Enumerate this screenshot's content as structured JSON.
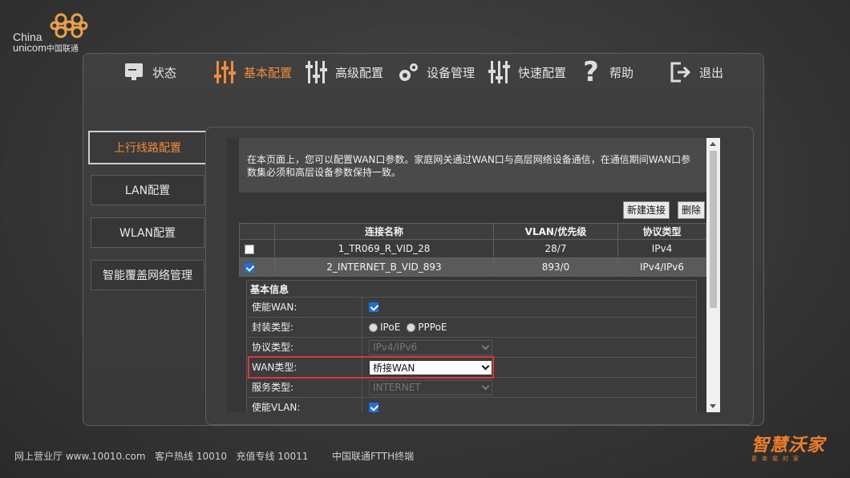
{
  "logo": {
    "en_line1": "China",
    "en_line2": "unicom",
    "cn": "中国联通"
  },
  "nav": [
    {
      "label": "状态",
      "icon": "monitor-icon"
    },
    {
      "label": "基本配置",
      "icon": "sliders-icon"
    },
    {
      "label": "高级配置",
      "icon": "sliders-advanced-icon"
    },
    {
      "label": "设备管理",
      "icon": "gears-icon"
    },
    {
      "label": "快速配置",
      "icon": "quick-sliders-icon"
    },
    {
      "label": "帮助",
      "icon": "question-icon"
    },
    {
      "label": "退出",
      "icon": "exit-icon"
    }
  ],
  "active_color": "#f08a3c",
  "menu": [
    {
      "label": "上行线路配置"
    },
    {
      "label": "LAN配置"
    },
    {
      "label": "WLAN配置"
    },
    {
      "label": "智能覆盖网络管理"
    }
  ],
  "description": "在本页面上，您可以配置WAN口参数。家庭网关通过WAN口与高层网络设备通信，在通信期间WAN口参数集必须和高层设备参数保持一致。",
  "buttons": {
    "new": "新建连接",
    "delete": "删除"
  },
  "table": {
    "headers": [
      "连接名称",
      "VLAN/优先级",
      "协议类型"
    ],
    "rows": [
      {
        "name": "1_TR069_R_VID_28",
        "vlan": "28/7",
        "proto": "IPv4",
        "checked": false
      },
      {
        "name": "2_INTERNET_B_VID_893",
        "vlan": "893/0",
        "proto": "IPv4/IPv6",
        "checked": true
      }
    ]
  },
  "basic": {
    "title": "基本信息",
    "enable_wan_label": "使能WAN:",
    "encap_label": "封装类型:",
    "encap_opt1": "IPoE",
    "encap_opt2": "PPPoE",
    "proto_label": "协议类型:",
    "proto_value": "IPv4/IPv6",
    "wantype_label": "WAN类型:",
    "wantype_value": "桥接WAN",
    "service_label": "服务类型:",
    "service_value": "INTERNET",
    "vlan_label": "使能VLAN:"
  },
  "footer": {
    "left": "网上营业厅 www.10010.com   客户热线 10010   充值专线 10011",
    "middle": "中国联通FTTH终端"
  },
  "brand": {
    "name": "智慧沃家",
    "tagline": "更幸福的家"
  }
}
